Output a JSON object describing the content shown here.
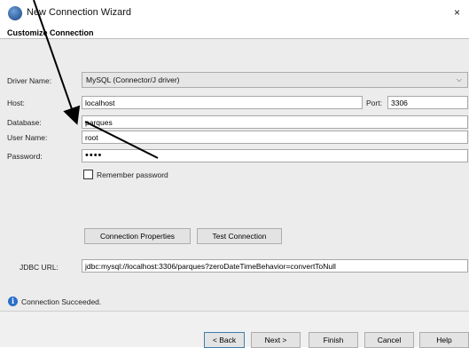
{
  "window": {
    "title": "New Connection Wizard",
    "close_glyph": "×",
    "icon": "netbeans-icon"
  },
  "section": {
    "title": "Customize Connection"
  },
  "form": {
    "driver": {
      "label": "Driver Name:",
      "value": "MySQL (Connector/J driver)"
    },
    "host": {
      "label": "Host:",
      "value": "localhost"
    },
    "port": {
      "label": "Port:",
      "value": "3306"
    },
    "database": {
      "label": "Database:",
      "value": "parques"
    },
    "user": {
      "label": "User Name:",
      "value": "root"
    },
    "password": {
      "label": "Password:",
      "value": "••••"
    },
    "remember": {
      "label": "Remember password",
      "checked": false
    },
    "connection_properties_label": "Connection Properties",
    "test_connection_label": "Test Connection",
    "jdbc": {
      "label": "JDBC URL:",
      "value": "jdbc:mysql://localhost:3306/parques?zeroDateTimeBehavior=convertToNull"
    }
  },
  "status": {
    "text": "Connection Succeeded.",
    "icon": "info-icon"
  },
  "footer": {
    "back": "< Back",
    "next": "Next >",
    "finish": "Finish",
    "cancel": "Cancel",
    "help": "Help"
  }
}
